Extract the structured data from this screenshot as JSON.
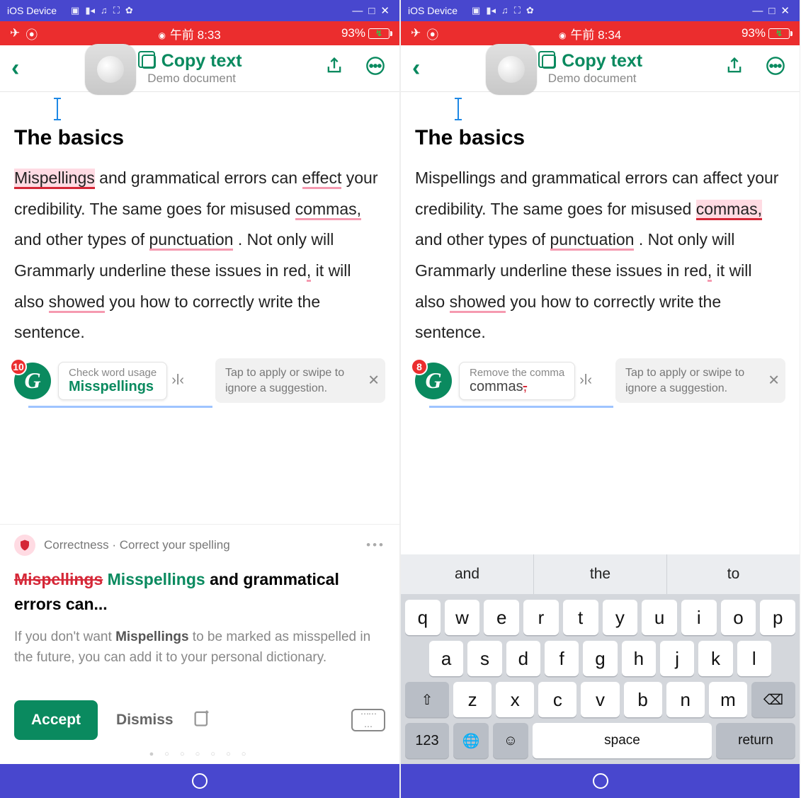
{
  "left": {
    "titlebar": {
      "label": "iOS Device"
    },
    "status": {
      "time": "午前 8:33",
      "battery": "93%"
    },
    "app": {
      "title": "Copy text",
      "subtitle": "Demo document"
    },
    "doc": {
      "heading": "The basics",
      "w_mispellings": "Mispellings",
      "t1": " and grammatical errors can ",
      "w_effect": "effect",
      "t2": " your credibility. The same goes for misused ",
      "w_commas": "commas,",
      "t3": " and other types of ",
      "w_punct": "punctuation",
      "t4": " . Not only will Grammarly underline these issues in red",
      "comma1": ",",
      "t5": " it will also ",
      "w_showed": "showed",
      "t6": " you how to correctly write the sentence."
    },
    "bubbles": {
      "count": "10",
      "label": "Check word usage",
      "main": "Misspellings",
      "tooltip": "Tap to apply or swipe to ignore a suggestion."
    },
    "card": {
      "cat": "Correctness · Correct your spelling",
      "old": "Mispellings",
      "new": "Misspellings",
      "rest": " and grammatical errors can...",
      "tip_a": "If you don't want ",
      "tip_b": "Mispellings",
      "tip_c": " to be marked as misspelled in the future, you can add it to your personal dictionary.",
      "accept": "Accept",
      "dismiss": "Dismiss"
    }
  },
  "right": {
    "titlebar": {
      "label": "iOS Device"
    },
    "status": {
      "time": "午前 8:34",
      "battery": "93%"
    },
    "app": {
      "title": "Copy text",
      "subtitle": "Demo document"
    },
    "doc": {
      "heading": "The basics",
      "t0": "Mispellings and grammatical errors can affect your credibility. The same goes for misused ",
      "w_commas": "commas,",
      "t3": " and other types of ",
      "w_punct": "punctuation",
      "t4": " . Not only will Grammarly underline these issues in red",
      "comma1": ",",
      "t5": " it will also ",
      "w_showed": "showed",
      "t6": " you how to correctly write the sentence."
    },
    "bubbles": {
      "count": "8",
      "label": "Remove the comma",
      "main_a": "commas",
      "main_b": ",",
      "tooltip": "Tap to apply or swipe to ignore a suggestion."
    },
    "keyboard": {
      "predictions": [
        "and",
        "the",
        "to"
      ],
      "row1": [
        "q",
        "w",
        "e",
        "r",
        "t",
        "y",
        "u",
        "i",
        "o",
        "p"
      ],
      "row2": [
        "a",
        "s",
        "d",
        "f",
        "g",
        "h",
        "j",
        "k",
        "l"
      ],
      "row3": [
        "z",
        "x",
        "c",
        "v",
        "b",
        "n",
        "m"
      ],
      "numkey": "123",
      "space": "space",
      "return": "return"
    }
  }
}
